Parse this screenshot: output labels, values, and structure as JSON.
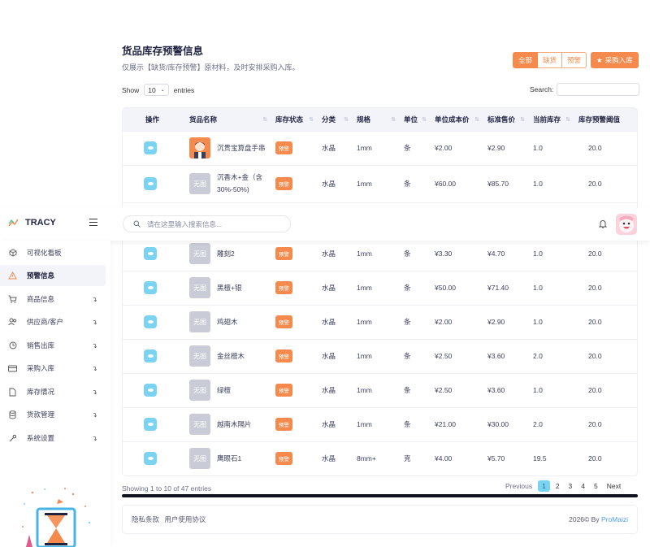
{
  "page": {
    "title": "货品库存预警信息",
    "subtitle": "仅展示【缺货/库存预警】原材料，及时安排采购入库。"
  },
  "filters": {
    "all": "全部",
    "out_of_stock": "缺货",
    "warning": "预警",
    "purchase": "采购入库"
  },
  "table_controls": {
    "show_label": "Show",
    "page_size": "10",
    "entries_label": "entries",
    "search_label": "Search:"
  },
  "columns": [
    "操作",
    "货品名称",
    "库存状态",
    "分类",
    "规格",
    "单位",
    "单位成本价",
    "标准售价",
    "当前库存",
    "库存预警阈值"
  ],
  "rows": [
    {
      "thumb": "",
      "name": "沉贵宝算盘手串",
      "name2": "",
      "status": "预警",
      "category": "水晶",
      "spec": "1mm",
      "unit": "条",
      "cost": "¥2.00",
      "price": "¥2.90",
      "stock": "1.0",
      "threshold": "20.0"
    },
    {
      "thumb": "无图",
      "name": "沉香木+金（含",
      "name2": "30%-50%)",
      "status": "预警",
      "category": "水晶",
      "spec": "1mm",
      "unit": "条",
      "cost": "¥60.00",
      "price": "¥85.70",
      "stock": "1.0",
      "threshold": "20.0"
    },
    {
      "thumb": "无图",
      "name": "雕刻2",
      "name2": "",
      "status": "预警",
      "category": "水晶",
      "spec": "1mm",
      "unit": "条",
      "cost": "¥3.30",
      "price": "¥4.70",
      "stock": "1.0",
      "threshold": "20.0"
    },
    {
      "thumb": "无图",
      "name": "黑檀+银",
      "name2": "",
      "status": "预警",
      "category": "水晶",
      "spec": "1mm",
      "unit": "条",
      "cost": "¥50.00",
      "price": "¥71.40",
      "stock": "1.0",
      "threshold": "20.0"
    },
    {
      "thumb": "无图",
      "name": "鸡翅木",
      "name2": "",
      "status": "预警",
      "category": "水晶",
      "spec": "1mm",
      "unit": "条",
      "cost": "¥2.00",
      "price": "¥2.90",
      "stock": "1.0",
      "threshold": "20.0"
    },
    {
      "thumb": "无图",
      "name": "金丝檀木",
      "name2": "",
      "status": "预警",
      "category": "水晶",
      "spec": "1mm",
      "unit": "条",
      "cost": "¥2.50",
      "price": "¥3.60",
      "stock": "2.0",
      "threshold": "20.0"
    },
    {
      "thumb": "无图",
      "name": "绿檀",
      "name2": "",
      "status": "预警",
      "category": "水晶",
      "spec": "1mm",
      "unit": "条",
      "cost": "¥2.50",
      "price": "¥3.60",
      "stock": "1.0",
      "threshold": "20.0"
    },
    {
      "thumb": "无图",
      "name": "越南木隔片",
      "name2": "",
      "status": "预警",
      "category": "水晶",
      "spec": "1mm",
      "unit": "条",
      "cost": "¥21.00",
      "price": "¥30.00",
      "stock": "2.0",
      "threshold": "20.0"
    },
    {
      "thumb": "无图",
      "name": "鹰眼石1",
      "name2": "",
      "status": "预警",
      "category": "水晶",
      "spec": "8mm+",
      "unit": "克",
      "cost": "¥4.00",
      "price": "¥5.70",
      "stock": "19.5",
      "threshold": "20.0"
    }
  ],
  "pagination": {
    "info": "Showing 1 to 10 of 47 entries",
    "previous": "Previous",
    "pages": [
      "1",
      "2",
      "3",
      "4",
      "5"
    ],
    "next": "Next"
  },
  "footer": {
    "privacy": "隐私条款",
    "terms": "用户使用协议",
    "copyright": "2026©  By",
    "brand": "ProMaizi"
  },
  "header": {
    "logo": "TRACY",
    "search_placeholder": "请在这里输入搜索信息..."
  },
  "sidebar": {
    "items": [
      {
        "label": "可视化看板",
        "icon": "cube-icon",
        "arrow": false
      },
      {
        "label": "预警信息",
        "icon": "warning-icon",
        "arrow": false
      },
      {
        "label": "商品信息",
        "icon": "cart-icon",
        "arrow": true
      },
      {
        "label": "供应商/客户",
        "icon": "users-icon",
        "arrow": true
      },
      {
        "label": "销售出库",
        "icon": "clock-icon",
        "arrow": true
      },
      {
        "label": "采购入库",
        "icon": "card-icon",
        "arrow": true
      },
      {
        "label": "库存情况",
        "icon": "file-icon",
        "arrow": true
      },
      {
        "label": "货款管理",
        "icon": "database-icon",
        "arrow": true
      },
      {
        "label": "系统设置",
        "icon": "wrench-icon",
        "arrow": true
      }
    ],
    "active_index": 1
  },
  "colors": {
    "accent": "#f58a4c",
    "info": "#7ad3f0",
    "link": "#4e9be6"
  }
}
